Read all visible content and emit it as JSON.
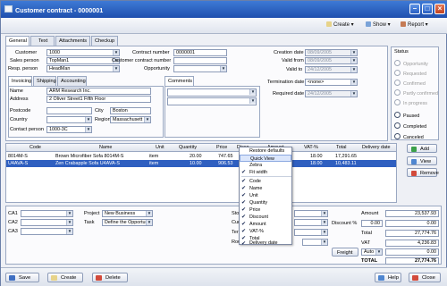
{
  "window": {
    "title": "Customer contract - 0000001"
  },
  "toolbar": {
    "create": "Create",
    "show": "Show",
    "report": "Report"
  },
  "tabs": [
    "General",
    "Text",
    "Attachments",
    "Checkup"
  ],
  "general": {
    "customer_label": "Customer",
    "customer_value": "1000",
    "sales_person_label": "Sales person",
    "sales_person_value": "TopMan1",
    "resp_person_label": "Resp. person",
    "resp_person_value": "HeadMan",
    "contract_number_label": "Contract number",
    "contract_number_value": "0000001",
    "customer_contract_number_label": "Customer contract number",
    "customer_contract_number_value": "",
    "opportunity_label": "Opportunity",
    "opportunity_value": "",
    "creation_date_label": "Creation date",
    "creation_date_value": "08/09/2005",
    "valid_from_label": "Valid from",
    "valid_from_value": "08/09/2005",
    "valid_to_label": "Valid to",
    "valid_to_value": "24/12/2005",
    "termination_date_label": "Termination date",
    "termination_date_value": "<none>",
    "required_date_label": "Required date",
    "required_date_value": "24/12/2005"
  },
  "status": {
    "title": "Status",
    "options": [
      "Opportunity",
      "Requested",
      "Confirmed",
      "Partly confirmed",
      "In progress",
      "Paused",
      "Completed",
      "Canceled"
    ]
  },
  "subtabs": [
    "Invoicing",
    "Shipping",
    "Accounting"
  ],
  "invoicing": {
    "name_label": "Name",
    "name_value": "ARM Research Inc.",
    "address_label": "Address",
    "address_value": "2 Oliver Street1 Fifth Floor",
    "postcode_label": "Postcode",
    "postcode_value": "",
    "city_label": "City",
    "city_value": "Boston",
    "country_label": "Country",
    "country_value": "",
    "region_label": "Region",
    "region_value": "Massachusett",
    "contact_label": "Contact person",
    "contact_value": "1000-3C"
  },
  "comments": {
    "title": "Comments"
  },
  "grid": {
    "headers": [
      "Code",
      "Name",
      "Unit",
      "Quantity",
      "Price",
      "Disco",
      "Amount",
      "VAT-%",
      "Total",
      "Delivery date"
    ],
    "rows": [
      {
        "code": "8014M-S",
        "name": "Brown Microfiber Sofa 8014M-S",
        "unit": "item",
        "quantity": "20.00",
        "price": "747.65",
        "vat": "18.00",
        "total": "17,291.65"
      },
      {
        "code": "U4AVA-S",
        "name": "Zen Crabapple Sofa U4AVA-S",
        "unit": "item",
        "quantity": "10.00",
        "price": "906.53",
        "vat": "18.00",
        "total": "10,483.11"
      }
    ]
  },
  "side_buttons": {
    "add": "Add",
    "view": "View",
    "remove": "Remove"
  },
  "context_menu": {
    "items": [
      {
        "label": "Restore defaults",
        "checked": false
      },
      {
        "label": "Quick View",
        "checked": false
      },
      {
        "label": "Zebra",
        "checked": false
      },
      {
        "label": "Fit width",
        "checked": true
      },
      {
        "label": "Code",
        "checked": true
      },
      {
        "label": "Name",
        "checked": true
      },
      {
        "label": "Unit",
        "checked": true
      },
      {
        "label": "Quantity",
        "checked": true
      },
      {
        "label": "Price",
        "checked": true
      },
      {
        "label": "Discount",
        "checked": true
      },
      {
        "label": "Amount",
        "checked": true
      },
      {
        "label": "VAT-%",
        "checked": true
      },
      {
        "label": "Total",
        "checked": true
      },
      {
        "label": "Delivery date",
        "checked": true
      }
    ],
    "highlighted": "Quick View"
  },
  "bottom": {
    "ca1_label": "CA1",
    "ca2_label": "CA2",
    "ca3_label": "CA3",
    "project_label": "Project",
    "project_value": "New Business",
    "task_label": "Task",
    "task_value": "Define the Opportur",
    "sto_label": "Sto",
    "cur_label": "Cur",
    "ter_label": "Terr",
    "rou_label": "Rou",
    "amount_label": "Amount",
    "amount_value": "23,537.93",
    "discount_label": "Discount %",
    "discount_pct": "0.00",
    "discount_value": "0.00",
    "total_label1": "Total",
    "total_value1": "27,774.76",
    "vat_label": "VAT",
    "vat_value": "4,236.83",
    "freight_label": "Freight",
    "freight_mode": "Auto",
    "freight_value": "0.00",
    "total_label2": "TOTAL",
    "total_value2": "27,774.76"
  },
  "footer": {
    "save": "Save",
    "create": "Create",
    "delete": "Delete",
    "help": "Help",
    "close": "Close"
  }
}
